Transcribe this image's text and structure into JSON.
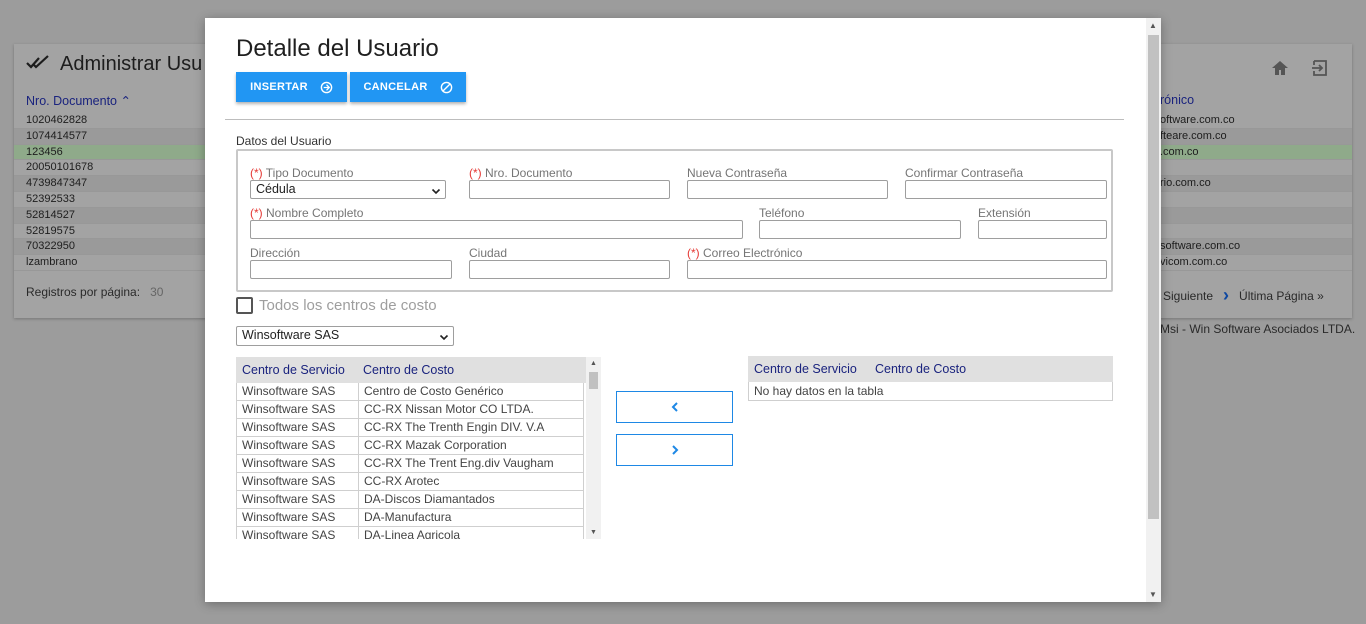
{
  "background": {
    "title": "Administrar Usu",
    "left_column_header": "Nro. Documento",
    "right_column_header": "rónico",
    "rows": [
      {
        "left": "1020462828",
        "right": "oftware.com.co"
      },
      {
        "left": "1074414577",
        "right": "fteare.com.co"
      },
      {
        "left": "123456",
        "right": ".com.co"
      },
      {
        "left": "20050101678",
        "right": ""
      },
      {
        "left": "4739847347",
        "right": "rio.com.co"
      },
      {
        "left": "52392533",
        "right": ""
      },
      {
        "left": "52814527",
        "right": ""
      },
      {
        "left": "52819575",
        "right": ""
      },
      {
        "left": "70322950",
        "right": "software.com.co"
      },
      {
        "left": "lzambrano",
        "right": "vicom.com.co"
      }
    ],
    "pager": {
      "registros_label": "Registros por página:",
      "registros_value": "30",
      "siguiente": "Siguiente",
      "ultima": "Última Página »"
    },
    "footer": "Msi - Win Software Asociados LTDA."
  },
  "modal": {
    "title": "Detalle del Usuario",
    "insert_label": "INSERTAR",
    "cancel_label": "CANCELAR",
    "section_label": "Datos del Usuario",
    "required_mark": "(*)",
    "fields": {
      "tipo_documento": {
        "label": "Tipo Documento",
        "value": "Cédula"
      },
      "nro_documento": {
        "label": "Nro. Documento"
      },
      "nueva_contrasena": {
        "label": "Nueva Contraseña"
      },
      "confirmar_contrasena": {
        "label": "Confirmar Contraseña"
      },
      "nombre_completo": {
        "label": "Nombre Completo"
      },
      "telefono": {
        "label": "Teléfono"
      },
      "extension": {
        "label": "Extensión"
      },
      "direccion": {
        "label": "Dirección"
      },
      "ciudad": {
        "label": "Ciudad"
      },
      "correo": {
        "label": "Correo Electrónico"
      }
    },
    "todos_label": "Todos los centros de costo",
    "company_select": "Winsoftware SAS",
    "left_table": {
      "headers": [
        "Centro de Servicio",
        "Centro de Costo"
      ],
      "rows": [
        [
          "Winsoftware SAS",
          "Centro de Costo Genérico"
        ],
        [
          "Winsoftware SAS",
          "CC-RX Nissan Motor CO LTDA."
        ],
        [
          "Winsoftware SAS",
          "CC-RX The Trenth Engin DIV. V.A"
        ],
        [
          "Winsoftware SAS",
          "CC-RX Mazak Corporation"
        ],
        [
          "Winsoftware SAS",
          "CC-RX The Trent Eng.div Vaugham"
        ],
        [
          "Winsoftware SAS",
          "CC-RX Arotec"
        ],
        [
          "Winsoftware SAS",
          "DA-Discos Diamantados"
        ],
        [
          "Winsoftware SAS",
          "DA-Manufactura"
        ],
        [
          "Winsoftware SAS",
          "DA-Linea Agricola"
        ]
      ]
    },
    "right_table": {
      "headers": [
        "Centro de Servicio",
        "Centro de Costo"
      ],
      "empty": "No hay datos en la tabla"
    }
  },
  "colors": {
    "primary": "#2196f3",
    "header_text": "#1a237e",
    "required": "#e53935",
    "selected_row": "#8faa8a"
  }
}
